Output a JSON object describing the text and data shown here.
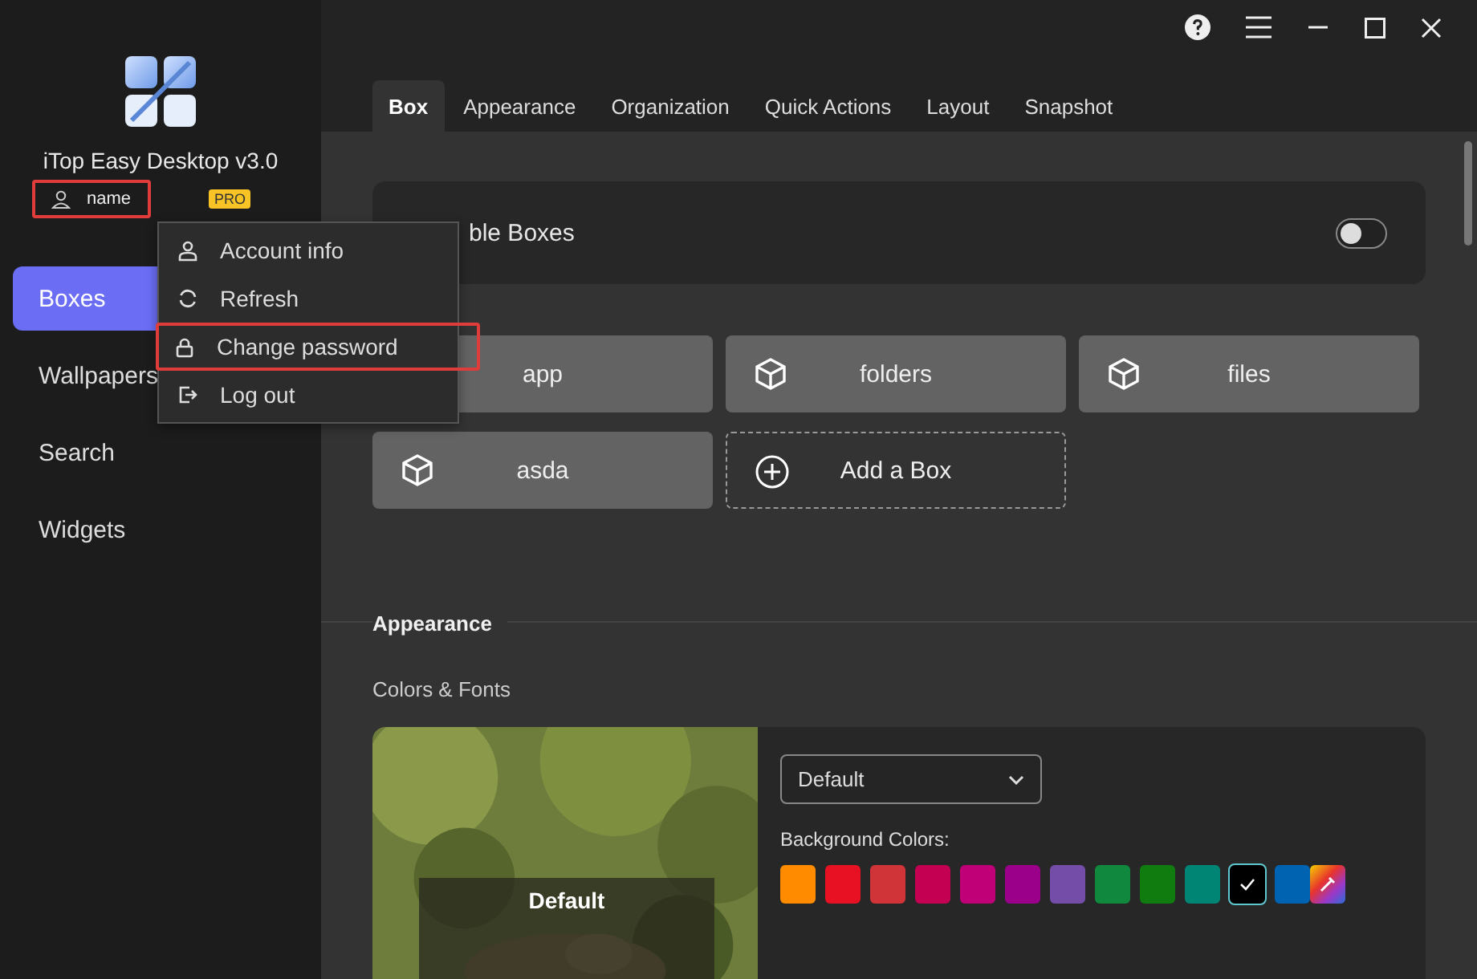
{
  "app": {
    "name": "iTop Easy Desktop v3.0",
    "user": "name",
    "badge": "PRO"
  },
  "nav": [
    {
      "label": "Boxes",
      "selected": true
    },
    {
      "label": "Wallpapers",
      "selected": false
    },
    {
      "label": "Search",
      "selected": false
    },
    {
      "label": "Widgets",
      "selected": false
    }
  ],
  "account_menu": [
    {
      "label": "Account info",
      "selected": false
    },
    {
      "label": "Refresh",
      "selected": false
    },
    {
      "label": "Change password",
      "selected": true
    },
    {
      "label": "Log out",
      "selected": false
    }
  ],
  "tabs": [
    {
      "label": "Box",
      "selected": true
    },
    {
      "label": "Appearance",
      "selected": false
    },
    {
      "label": "Organization",
      "selected": false
    },
    {
      "label": "Quick Actions",
      "selected": false
    },
    {
      "label": "Layout",
      "selected": false
    },
    {
      "label": "Snapshot",
      "selected": false
    }
  ],
  "enable_boxes": {
    "label": "ble Boxes",
    "on": false
  },
  "boxes": [
    {
      "kind": "box",
      "name": "app"
    },
    {
      "kind": "box",
      "name": "folders"
    },
    {
      "kind": "box",
      "name": "files"
    },
    {
      "kind": "box",
      "name": "asda"
    },
    {
      "kind": "add",
      "name": "Add a Box"
    }
  ],
  "appearance": {
    "heading": "Appearance",
    "subheading": "Colors & Fonts",
    "preview_label": "Default",
    "theme_select": "Default",
    "colors_label": "Background Colors:",
    "colors": [
      {
        "kind": "swatch",
        "color": "#ff8c00",
        "selected": false
      },
      {
        "kind": "swatch",
        "color": "#e81123",
        "selected": false
      },
      {
        "kind": "swatch",
        "color": "#d13438",
        "selected": false
      },
      {
        "kind": "swatch",
        "color": "#c30052",
        "selected": false
      },
      {
        "kind": "swatch",
        "color": "#bf0077",
        "selected": false
      },
      {
        "kind": "swatch",
        "color": "#9a0089",
        "selected": false
      },
      {
        "kind": "swatch",
        "color": "#744da9",
        "selected": false
      },
      {
        "kind": "swatch",
        "color": "#10893e",
        "selected": false
      },
      {
        "kind": "swatch",
        "color": "#107c10",
        "selected": false
      },
      {
        "kind": "swatch",
        "color": "#008575",
        "selected": false
      },
      {
        "kind": "swatch",
        "color": "#000000",
        "selected": true
      },
      {
        "kind": "swatch",
        "color": "#0063b1",
        "selected": false
      },
      {
        "kind": "custom",
        "selected": false
      }
    ]
  }
}
